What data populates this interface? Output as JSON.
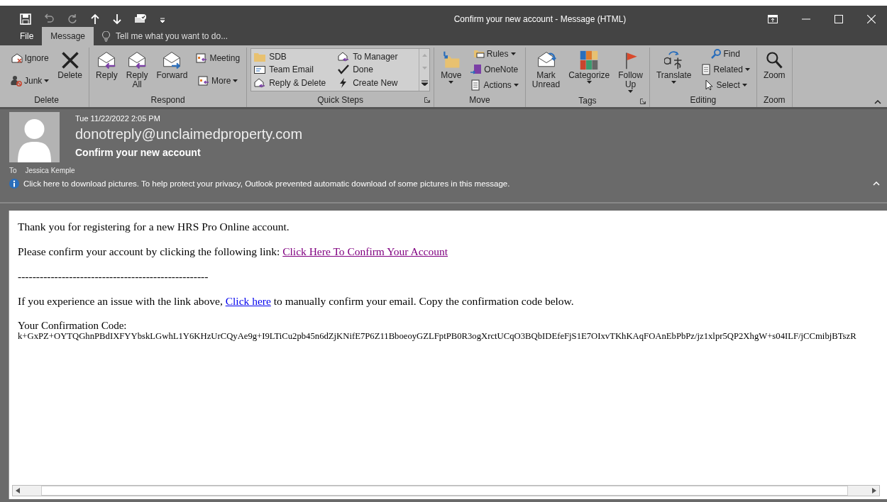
{
  "window": {
    "title": "Confirm your new account - Message (HTML)"
  },
  "tabs": [
    {
      "label": "File",
      "selected": false
    },
    {
      "label": "Message",
      "selected": true
    }
  ],
  "tell_me": {
    "placeholder": "Tell me what you want to do..."
  },
  "ribbon": {
    "groups": [
      {
        "label": "Delete",
        "launcher": false,
        "items": [
          {
            "kind": "small",
            "label": "Ignore",
            "dropdown": false
          },
          {
            "kind": "small",
            "label": "Junk",
            "dropdown": true
          },
          {
            "kind": "large",
            "label": "Delete",
            "dropdown": false
          }
        ]
      },
      {
        "label": "Respond",
        "launcher": false,
        "items": [
          {
            "kind": "large",
            "label": "Reply",
            "dropdown": false
          },
          {
            "kind": "large",
            "label": "Reply All",
            "dropdown": false
          },
          {
            "kind": "large",
            "label": "Forward",
            "dropdown": false
          },
          {
            "kind": "small",
            "label": "Meeting",
            "dropdown": false
          },
          {
            "kind": "small",
            "label": "More",
            "dropdown": true
          }
        ]
      },
      {
        "label": "Quick Steps",
        "launcher": true,
        "items": [
          {
            "kind": "gallery",
            "label": "SDB"
          },
          {
            "kind": "gallery",
            "label": "Team Email"
          },
          {
            "kind": "gallery",
            "label": "Reply & Delete"
          },
          {
            "kind": "gallery",
            "label": "To Manager"
          },
          {
            "kind": "gallery",
            "label": "Done"
          },
          {
            "kind": "gallery",
            "label": "Create New"
          }
        ]
      },
      {
        "label": "Move",
        "launcher": false,
        "items": [
          {
            "kind": "large",
            "label": "Move",
            "dropdown": true
          },
          {
            "kind": "small",
            "label": "Rules",
            "dropdown": true
          },
          {
            "kind": "small",
            "label": "OneNote",
            "dropdown": false
          },
          {
            "kind": "small",
            "label": "Actions",
            "dropdown": true
          }
        ]
      },
      {
        "label": "Tags",
        "launcher": true,
        "items": [
          {
            "kind": "large",
            "label": "Mark Unread",
            "dropdown": false
          },
          {
            "kind": "large",
            "label": "Categorize",
            "dropdown": true
          },
          {
            "kind": "large",
            "label": "Follow Up",
            "dropdown": true
          }
        ]
      },
      {
        "label": "Editing",
        "launcher": false,
        "items": [
          {
            "kind": "large",
            "label": "Translate",
            "dropdown": true
          },
          {
            "kind": "small",
            "label": "Find",
            "dropdown": false
          },
          {
            "kind": "small",
            "label": "Related",
            "dropdown": true
          },
          {
            "kind": "small",
            "label": "Select",
            "dropdown": true
          }
        ]
      },
      {
        "label": "Zoom",
        "launcher": false,
        "items": [
          {
            "kind": "large",
            "label": "Zoom",
            "dropdown": false
          }
        ]
      }
    ]
  },
  "header": {
    "date": "Tue 11/22/2022 2:05 PM",
    "sender": "donotreply@unclaimedproperty.com",
    "subject": "Confirm your new account",
    "to_label": "To",
    "recipient": "Jessica Kemple",
    "info": "Click here to download pictures. To help protect your privacy, Outlook prevented automatic download of some pictures in this message."
  },
  "body": [
    {
      "kind": "text",
      "segments": [
        {
          "kind": "text",
          "text": "Thank you for registering for a new HRS Pro Online account."
        }
      ]
    },
    {
      "kind": "text",
      "segments": [
        {
          "kind": "text",
          "text": "Please confirm your account by clicking the following link: "
        },
        {
          "kind": "link",
          "text": "Click Here To Confirm Your Account",
          "visited": true
        }
      ]
    },
    {
      "kind": "text",
      "segments": [
        {
          "kind": "text",
          "text": "----------------------------------------------------"
        }
      ]
    },
    {
      "kind": "text",
      "segments": [
        {
          "kind": "text",
          "text": "If you experience an issue with the link above, "
        },
        {
          "kind": "link",
          "text": "Click here",
          "visited": false
        },
        {
          "kind": "text",
          "text": " to manually confirm your email. Copy the confirmation code below."
        }
      ]
    },
    {
      "kind": "code",
      "label": "Your Confirmation Code:",
      "code": "k+GxPZ+OYTQGhnPBdIXFYYbskLGwhL1Y6KHzUrCQyAe9g+I9LTiCu2pb45n6dZjKNifE7P6Z11BboeoyGZLFptPB0R3ogXrctUCqO3BQbIDEfeFjS1E7OIxvTKhKAqFOAnEbPbPz/jz1xlpr5QP2XhgW+s04ILF/jCCmibjBTszR"
    }
  ]
}
